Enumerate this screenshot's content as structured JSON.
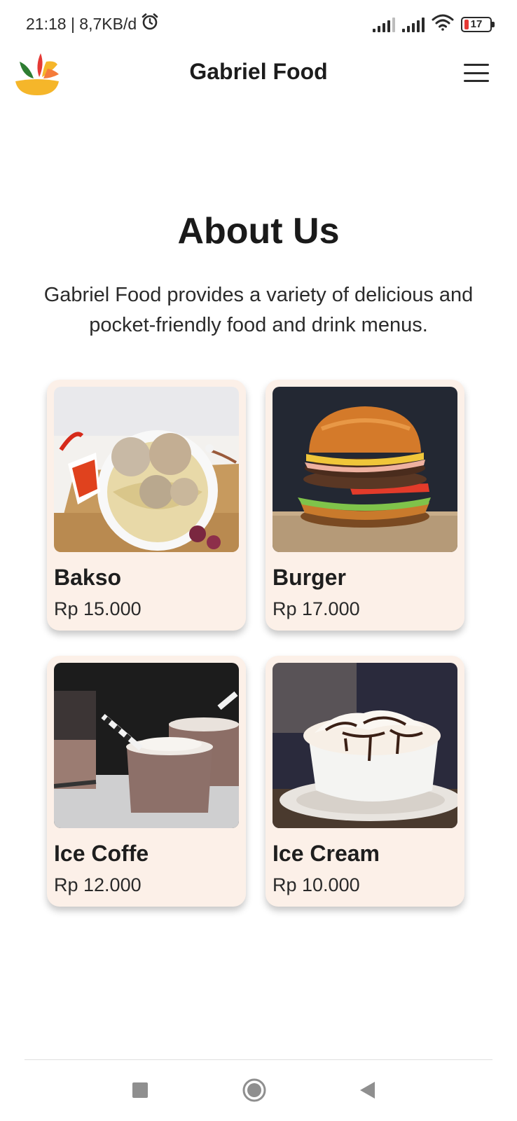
{
  "status_bar": {
    "time_speed": "21:18 | 8,7KB/d",
    "battery": "17"
  },
  "header": {
    "title": "Gabriel Food"
  },
  "about": {
    "title": "About Us",
    "description": "Gabriel Food provides a variety of delicious and pocket-friendly food and drink menus."
  },
  "menu_items": [
    {
      "name": "Bakso",
      "price": "Rp 15.000"
    },
    {
      "name": "Burger",
      "price": "Rp 17.000"
    },
    {
      "name": "Ice Coffe",
      "price": "Rp 12.000"
    },
    {
      "name": "Ice Cream",
      "price": "Rp 10.000"
    }
  ],
  "colors": {
    "card_background": "#fcf0e8",
    "logo_yellow": "#f5b62a",
    "logo_green": "#2e7d32",
    "logo_red": "#e53935",
    "logo_orange": "#f57c3a"
  }
}
